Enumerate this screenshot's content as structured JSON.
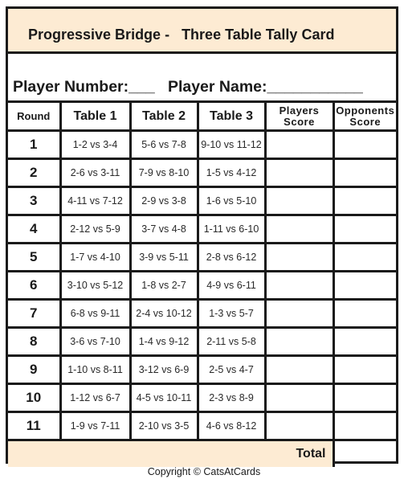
{
  "title": "Progressive Bridge -   Three Table Tally Card",
  "player_line": {
    "number_label": "Player Number:___",
    "name_label": "Player Name:___________"
  },
  "colors": {
    "header_bg": "#fdebd3",
    "border": "#1a1a1a"
  },
  "table": {
    "headers": {
      "round": "Round",
      "table1": "Table 1",
      "table2": "Table 2",
      "table3": "Table 3",
      "players_score_1": "Players",
      "players_score_2": "Score",
      "opponents_score_1": "Opponents",
      "opponents_score_2": "Score"
    },
    "rows": [
      {
        "round": "1",
        "t1": "1-2 vs 3-4",
        "t2": "5-6 vs 7-8",
        "t3": "9-10 vs 11-12",
        "players": "",
        "opponents": ""
      },
      {
        "round": "2",
        "t1": "2-6 vs 3-11",
        "t2": "7-9 vs 8-10",
        "t3": "1-5 vs 4-12",
        "players": "",
        "opponents": ""
      },
      {
        "round": "3",
        "t1": "4-11 vs 7-12",
        "t2": "2-9 vs 3-8",
        "t3": "1-6 vs 5-10",
        "players": "",
        "opponents": ""
      },
      {
        "round": "4",
        "t1": "2-12 vs 5-9",
        "t2": "3-7 vs 4-8",
        "t3": "1-11 vs 6-10",
        "players": "",
        "opponents": ""
      },
      {
        "round": "5",
        "t1": "1-7 vs 4-10",
        "t2": "3-9 vs 5-11",
        "t3": "2-8 vs 6-12",
        "players": "",
        "opponents": ""
      },
      {
        "round": "6",
        "t1": "3-10 vs 5-12",
        "t2": "1-8 vs 2-7",
        "t3": "4-9 vs 6-11",
        "players": "",
        "opponents": ""
      },
      {
        "round": "7",
        "t1": "6-8 vs 9-11",
        "t2": "2-4 vs 10-12",
        "t3": "1-3 vs 5-7",
        "players": "",
        "opponents": ""
      },
      {
        "round": "8",
        "t1": "3-6 vs 7-10",
        "t2": "1-4 vs 9-12",
        "t3": "2-11 vs 5-8",
        "players": "",
        "opponents": ""
      },
      {
        "round": "9",
        "t1": "1-10 vs 8-11",
        "t2": "3-12 vs 6-9",
        "t3": "2-5 vs 4-7",
        "players": "",
        "opponents": ""
      },
      {
        "round": "10",
        "t1": "1-12 vs 6-7",
        "t2": "4-5 vs 10-11",
        "t3": "2-3 vs 8-9",
        "players": "",
        "opponents": ""
      },
      {
        "round": "11",
        "t1": "1-9 vs 7-11",
        "t2": "2-10 vs 3-5",
        "t3": "4-6 vs 8-12",
        "players": "",
        "opponents": ""
      }
    ],
    "total_label": "Total",
    "total_value": ""
  },
  "copyright": "Copyright © CatsAtCards"
}
